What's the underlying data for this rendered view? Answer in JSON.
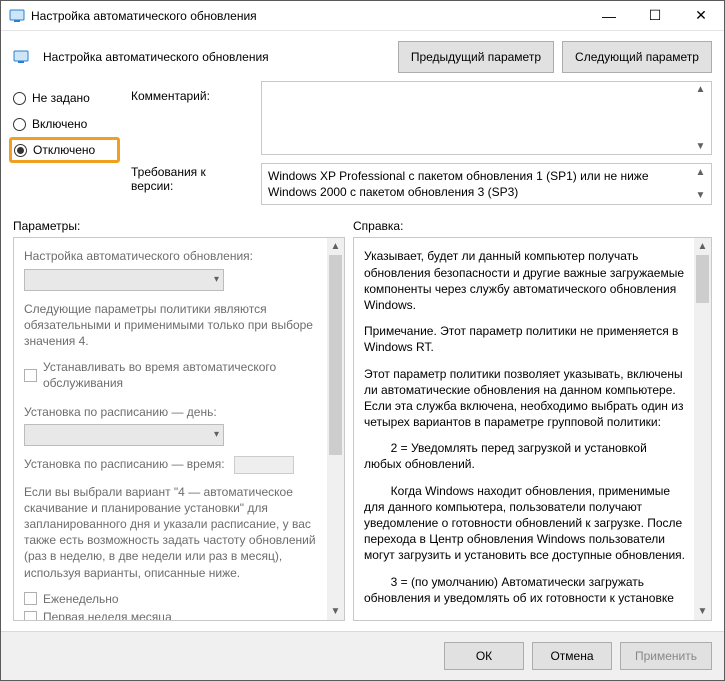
{
  "window": {
    "title": "Настройка автоматического обновления",
    "minimize_label": "—",
    "maximize_label": "☐",
    "close_label": "✕"
  },
  "header": {
    "setting_title": "Настройка автоматического обновления",
    "prev_button": "Предыдущий параметр",
    "next_button": "Следующий параметр"
  },
  "radios": {
    "not_configured": "Не задано",
    "enabled": "Включено",
    "disabled": "Отключено",
    "selected": "disabled"
  },
  "labels": {
    "comment": "Комментарий:",
    "requirements_prefix": "Требования к версии:",
    "parameters": "Параметры:",
    "help": "Справка:"
  },
  "version_text": "Windows XP Professional с пакетом обновления 1 (SP1) или не ниже Windows 2000 с пакетом обновления 3 (SP3)",
  "params_panel": {
    "heading": "Настройка автоматического обновления:",
    "note": "Следующие параметры политики являются обязательными и применимыми только при выборе значения 4.",
    "cb_auto_maint": "Устанавливать во время автоматического обслуживания",
    "install_day_label": "Установка по расписанию — день:",
    "install_time_label": "Установка по расписанию — время:",
    "variant4_text": "Если вы выбрали вариант \"4 — автоматическое скачивание и планирование установки\" для запланированного дня и указали расписание, у вас также есть возможность задать частоту обновлений (раз в неделю, в две недели или раз в месяц), используя варианты, описанные ниже.",
    "cb_weekly": "Еженедельно",
    "cb_first_week": "Первая неделя месяца"
  },
  "help_panel": {
    "p1": "Указывает, будет ли данный компьютер получать обновления безопасности и другие важные загружаемые компоненты через службу автоматического обновления Windows.",
    "p2": "Примечание. Этот параметр политики не применяется в Windows RT.",
    "p3": "Этот параметр политики позволяет указывать, включены ли автоматические обновления на данном компьютере. Если эта служба включена, необходимо выбрать один из четырех вариантов в параметре групповой политики:",
    "opt2_head": "        2 = Уведомлять перед загрузкой и установкой любых обновлений.",
    "opt2_body": "        Когда Windows находит обновления, применимые для данного компьютера, пользователи получают уведомление о готовности обновлений к загрузке. После перехода в Центр обновления Windows пользователи могут загрузить и установить все доступные обновления.",
    "opt3_head": "        3 = (по умолчанию) Автоматически загружать обновления и уведомлять об их готовности к установке"
  },
  "footer": {
    "ok": "ОК",
    "cancel": "Отмена",
    "apply": "Применить"
  }
}
